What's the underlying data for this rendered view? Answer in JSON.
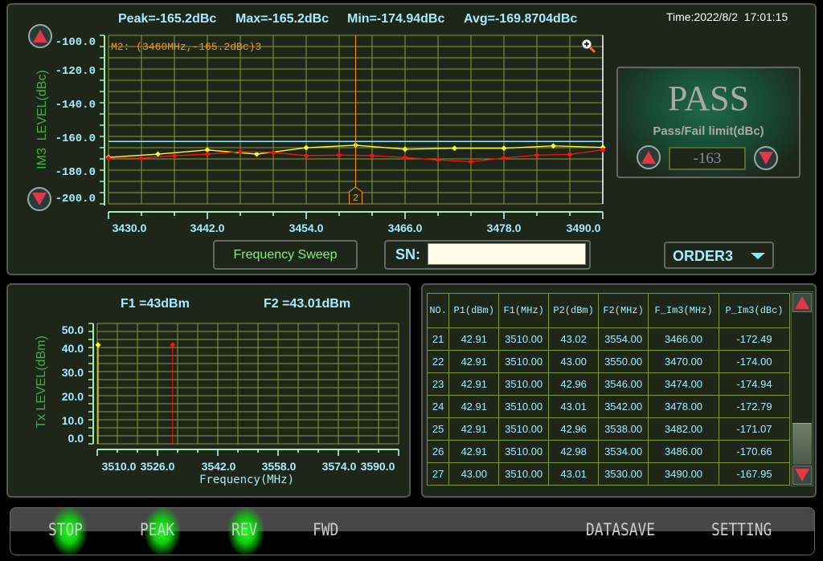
{
  "header": {
    "peak": "Peak=-165.2dBc",
    "max": "Max=-165.2dBc",
    "min": "Min=-174.94dBc",
    "avg": "Avg=-169.8704dBc",
    "time": "Time:2022/8/2  17:01:15"
  },
  "im3_chart": {
    "ylabel": "IM3  LEVEL(dBc)",
    "marker_label": "M2: (3460MHz,-165.2dBc)3",
    "marker_tag": "2",
    "colors": {
      "limit": "#8ff0f0",
      "series_red": "#ff1010",
      "series_yellow": "#ffff20",
      "marker": "#ff9900",
      "grid": "#8a9a3a"
    }
  },
  "chart_data": [
    {
      "type": "line",
      "ylabel": "IM3  LEVEL(dBc)",
      "xlim": [
        3430,
        3490
      ],
      "ylim": [
        -200,
        -100
      ],
      "x_ticks": [
        "3430.0",
        "3442.0",
        "3454.0",
        "3466.0",
        "3478.0",
        "3490.0"
      ],
      "y_ticks": [
        "-100.0",
        "-120.0",
        "-140.0",
        "-160.0",
        "-180.0",
        "-200.0"
      ],
      "grid": true,
      "limit_line": -163,
      "marker": {
        "x": 3460,
        "y": -165.2
      },
      "series": [
        {
          "color": "#ff1010",
          "x": [
            3430,
            3434,
            3438,
            3442,
            3446,
            3450,
            3454,
            3458,
            3462,
            3466,
            3470,
            3474,
            3478,
            3482,
            3486,
            3490
          ],
          "y": [
            -172.9,
            -172.9,
            -171.4,
            -170.5,
            -169,
            -169.5,
            -171.4,
            -171,
            -171.4,
            -172.49,
            -174,
            -174.94,
            -172.79,
            -171.07,
            -170.66,
            -167.95
          ]
        },
        {
          "color": "#ffff20",
          "x": [
            3430,
            3436,
            3442,
            3448,
            3454,
            3460,
            3466,
            3472,
            3478,
            3484,
            3490
          ],
          "y": [
            -172.4,
            -170.5,
            -168,
            -170.5,
            -166.7,
            -165.2,
            -167.6,
            -167,
            -167,
            -165.6,
            -166.5
          ]
        }
      ]
    },
    {
      "type": "scatter",
      "title_f1": "F1 =43dBm",
      "title_f2": "F2 =43.01dBm",
      "ylabel": "Tx LEVEL(dBm)",
      "xlabel": "Frequency(MHz)",
      "xlim": [
        3510,
        3590
      ],
      "ylim": [
        0,
        50
      ],
      "x_ticks": [
        "3510.0",
        "3526.0",
        "3542.0",
        "3558.0",
        "3574.0",
        "3590.0"
      ],
      "y_ticks": [
        "50.0",
        "40.0",
        "30.0",
        "20.0",
        "10.0",
        "0.0"
      ],
      "grid": true,
      "points": [
        {
          "x": 3510,
          "y": 43,
          "color": "#ffff20"
        },
        {
          "x": 3530,
          "y": 43.01,
          "color": "#ff1010"
        }
      ]
    }
  ],
  "pass_panel": {
    "result": "PASS",
    "limit_label": "Pass/Fail limit(dBc)",
    "limit_value": "-163"
  },
  "controls": {
    "sweep_label": "Frequency Sweep",
    "sn_label": "SN:",
    "sn_value": "",
    "order_value": "ORDER3"
  },
  "table": {
    "headers": [
      "NO.",
      "P1(dBm)",
      "F1(MHz)",
      "P2(dBm)",
      "F2(MHz)",
      "F_Im3(MHz)",
      "P_Im3(dBc)"
    ],
    "rows": [
      [
        "21",
        "42.91",
        "3510.00",
        "43.02",
        "3554.00",
        "3466.00",
        "-172.49"
      ],
      [
        "22",
        "42.91",
        "3510.00",
        "43.00",
        "3550.00",
        "3470.00",
        "-174.00"
      ],
      [
        "23",
        "42.91",
        "3510.00",
        "42.96",
        "3546.00",
        "3474.00",
        "-174.94"
      ],
      [
        "24",
        "42.91",
        "3510.00",
        "43.01",
        "3542.00",
        "3478.00",
        "-172.79"
      ],
      [
        "25",
        "42.91",
        "3510.00",
        "42.96",
        "3538.00",
        "3482.00",
        "-171.07"
      ],
      [
        "26",
        "42.91",
        "3510.00",
        "42.98",
        "3534.00",
        "3486.00",
        "-170.66"
      ],
      [
        "27",
        "43.00",
        "3510.00",
        "43.01",
        "3530.00",
        "3490.00",
        "-167.95"
      ]
    ]
  },
  "toolbar": {
    "stop": "STOP",
    "peak": "PEAK",
    "rev": "REV",
    "fwd": "FWD",
    "datasave": "DATASAVE",
    "setting": "SETTING"
  }
}
